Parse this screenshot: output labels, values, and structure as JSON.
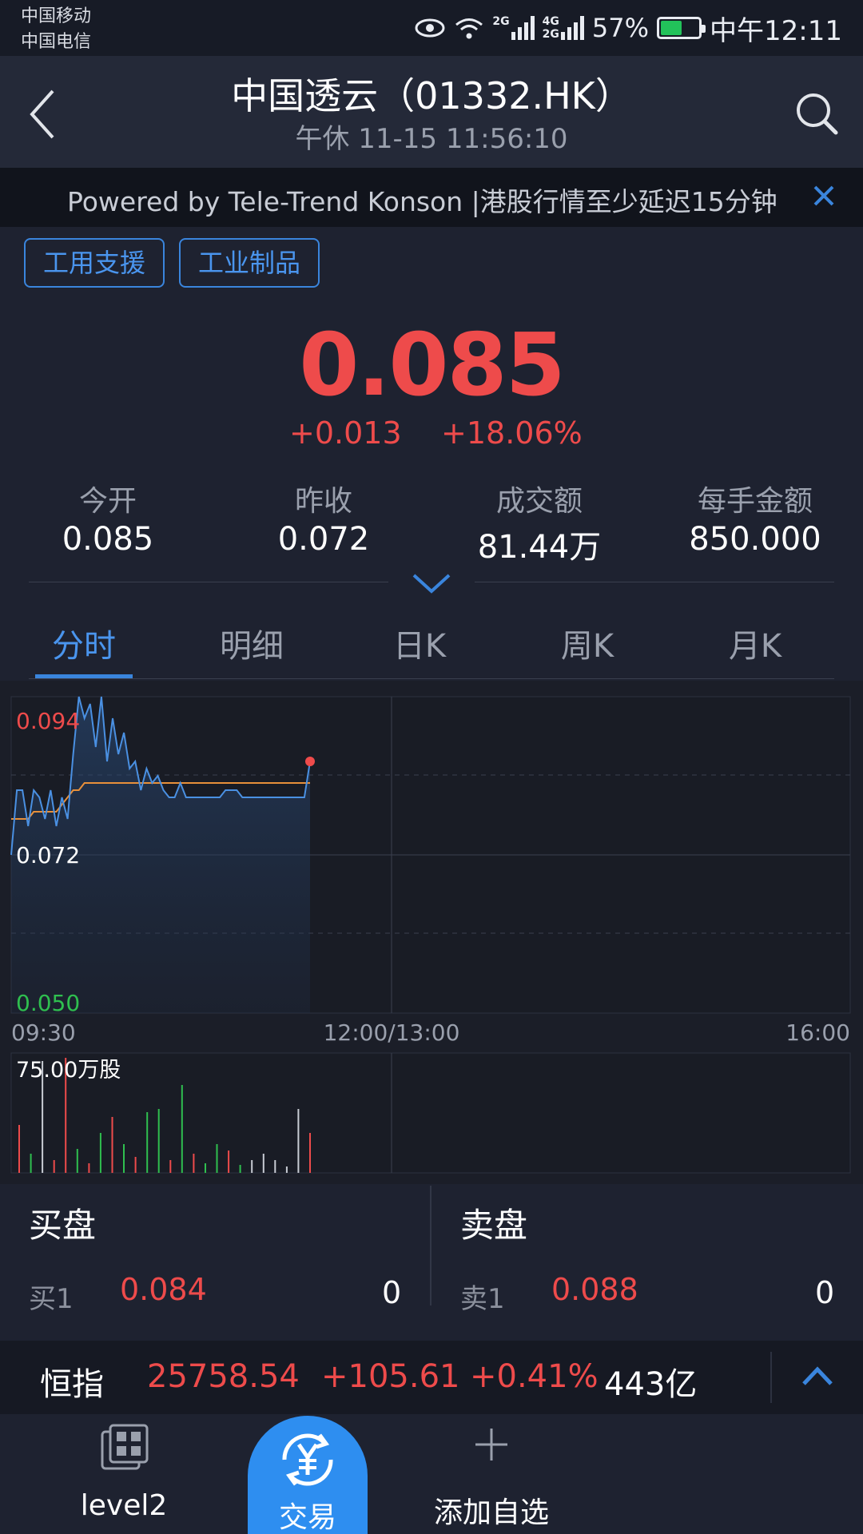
{
  "status_bar": {
    "carrier_1": "中国移动",
    "carrier_2": "中国电信",
    "net_1": "2G",
    "net_2a": "4G",
    "net_2b": "2G",
    "battery": "57%",
    "battery_level": 0.57,
    "time": "中午12:11"
  },
  "header": {
    "title": "中国透云（01332.HK）",
    "subtitle": "午休  11-15  11:56:10"
  },
  "notice": {
    "text": "Powered by Tele-Trend Konson |港股行情至少延迟15分钟"
  },
  "tags": [
    "工用支援",
    "工业制品"
  ],
  "quote": {
    "price": "0.085",
    "change": "+0.013",
    "change_pct": "+18.06%"
  },
  "stats": [
    {
      "label": "今开",
      "value": "0.085"
    },
    {
      "label": "昨收",
      "value": "0.072"
    },
    {
      "label": "成交额",
      "value": "81.44万"
    },
    {
      "label": "每手金额",
      "value": "850.000"
    }
  ],
  "tabs": [
    "分时",
    "明细",
    "日K",
    "周K",
    "月K"
  ],
  "chart": {
    "price_high": "0.094",
    "price_mid": "0.072",
    "price_low": "0.050",
    "time_start": "09:30",
    "time_mid": "12:00/13:00",
    "time_end": "16:00",
    "volume_label": "75.00万股",
    "colors": {
      "up": "#ee4b4b",
      "down": "#2fbf4f",
      "price_line": "#4a90e2",
      "avg_line": "#e8903a"
    }
  },
  "chart_data": {
    "type": "line",
    "x_ticks": [
      "09:30",
      "12:00/13:00",
      "16:00"
    ],
    "ylim": [
      0.05,
      0.094
    ],
    "series": [
      {
        "name": "price",
        "values": [
          0.072,
          0.081,
          0.081,
          0.076,
          0.081,
          0.08,
          0.077,
          0.081,
          0.076,
          0.08,
          0.077,
          0.086,
          0.094,
          0.091,
          0.093,
          0.087,
          0.094,
          0.085,
          0.091,
          0.086,
          0.089,
          0.084,
          0.085,
          0.081,
          0.084,
          0.082,
          0.083,
          0.081,
          0.08,
          0.08,
          0.082,
          0.08,
          0.08,
          0.08,
          0.08,
          0.08,
          0.08,
          0.08,
          0.081,
          0.081,
          0.081,
          0.08,
          0.08,
          0.08,
          0.08,
          0.08,
          0.08,
          0.08,
          0.08,
          0.08,
          0.08,
          0.08,
          0.08,
          0.085
        ]
      },
      {
        "name": "average",
        "values": [
          0.077,
          0.077,
          0.077,
          0.077,
          0.078,
          0.078,
          0.078,
          0.078,
          0.078,
          0.079,
          0.08,
          0.081,
          0.081,
          0.082,
          0.082,
          0.082,
          0.082,
          0.082,
          0.082,
          0.082,
          0.082,
          0.082,
          0.082,
          0.082,
          0.082,
          0.082,
          0.082,
          0.082,
          0.082,
          0.082,
          0.082,
          0.082,
          0.082,
          0.082,
          0.082,
          0.082,
          0.082,
          0.082,
          0.082,
          0.082,
          0.082,
          0.082,
          0.082,
          0.082,
          0.082,
          0.082,
          0.082,
          0.082,
          0.082,
          0.082,
          0.082,
          0.082,
          0.082,
          0.082
        ]
      }
    ],
    "volume_max": 75,
    "volume": [
      {
        "v": 30,
        "c": "up"
      },
      {
        "v": 12,
        "c": "down"
      },
      {
        "v": 70,
        "c": "neutral"
      },
      {
        "v": 8,
        "c": "up"
      },
      {
        "v": 72,
        "c": "up"
      },
      {
        "v": 15,
        "c": "down"
      },
      {
        "v": 6,
        "c": "up"
      },
      {
        "v": 25,
        "c": "down"
      },
      {
        "v": 35,
        "c": "up"
      },
      {
        "v": 18,
        "c": "down"
      },
      {
        "v": 10,
        "c": "up"
      },
      {
        "v": 38,
        "c": "down"
      },
      {
        "v": 40,
        "c": "down"
      },
      {
        "v": 8,
        "c": "up"
      },
      {
        "v": 55,
        "c": "down"
      },
      {
        "v": 12,
        "c": "up"
      },
      {
        "v": 6,
        "c": "down"
      },
      {
        "v": 18,
        "c": "down"
      },
      {
        "v": 14,
        "c": "up"
      },
      {
        "v": 5,
        "c": "down"
      },
      {
        "v": 8,
        "c": "neutral"
      },
      {
        "v": 12,
        "c": "neutral"
      },
      {
        "v": 8,
        "c": "neutral"
      },
      {
        "v": 4,
        "c": "neutral"
      },
      {
        "v": 40,
        "c": "neutral"
      },
      {
        "v": 25,
        "c": "up"
      }
    ]
  },
  "order_book": {
    "buy_title": "买盘",
    "sell_title": "卖盘",
    "buy": {
      "label": "买1",
      "price": "0.084",
      "qty": "0"
    },
    "sell": {
      "label": "卖1",
      "price": "0.088",
      "qty": "0"
    }
  },
  "index_bar": {
    "name": "恒指",
    "value": "25758.54",
    "change": "+105.61",
    "change_pct": "+0.41%",
    "turnover": "443亿"
  },
  "bottom_nav": {
    "level2": "level2",
    "trade": "交易",
    "add": "添加自选"
  }
}
